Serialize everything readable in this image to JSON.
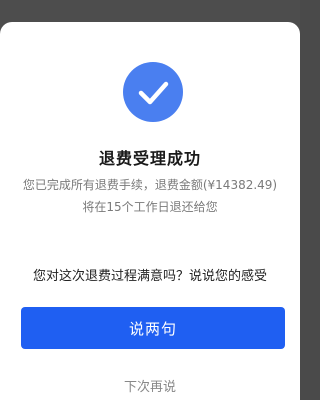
{
  "dialog": {
    "icon": "checkmark-circle-icon",
    "accent_color": "#4a7ff0",
    "title": "退费受理成功",
    "description_line1": "您已完成所有退费手续，退费金额(¥14382.49)",
    "description_line2": "将在15个工作日退还给您",
    "survey_prompt": "您对这次退费过程满意吗？说说您的感受",
    "primary_button_label": "说两句",
    "primary_button_color": "#1f5ff2",
    "secondary_link_label": "下次再说"
  }
}
